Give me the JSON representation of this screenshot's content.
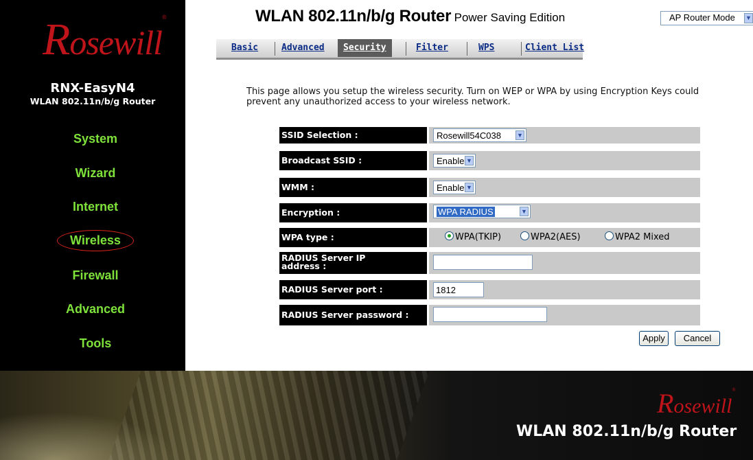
{
  "brand": {
    "logo_rest": "osewill",
    "logo_cap": "R",
    "registered": "®"
  },
  "sidebar": {
    "model": "RNX-EasyN4",
    "model_sub": "WLAN 802.11n/b/g Router",
    "items": [
      {
        "label": "System"
      },
      {
        "label": "Wizard"
      },
      {
        "label": "Internet"
      },
      {
        "label": "Wireless"
      },
      {
        "label": "Firewall"
      },
      {
        "label": "Advanced"
      },
      {
        "label": "Tools"
      }
    ],
    "active": "Wireless"
  },
  "header": {
    "title": "WLAN 802.11n/b/g Router",
    "subtitle": "Power Saving Edition",
    "mode_select": "AP Router Mode"
  },
  "tabs": [
    {
      "label": "Basic"
    },
    {
      "label": "Advanced"
    },
    {
      "label": "Security"
    },
    {
      "label": "Filter"
    },
    {
      "label": "WPS"
    },
    {
      "label": "Client List"
    }
  ],
  "active_tab": "Security",
  "description": "This page allows you setup the wireless security. Turn on WEP or WPA by using Encryption Keys could prevent any unauthorized access to your wireless network.",
  "form": {
    "ssid_selection": {
      "label": "SSID Selection :",
      "value": "Rosewill54C038"
    },
    "broadcast_ssid": {
      "label": "Broadcast SSID :",
      "value": "Enable"
    },
    "wmm": {
      "label": "WMM :",
      "value": "Enable"
    },
    "encryption": {
      "label": "Encryption :",
      "value": "WPA RADIUS"
    },
    "wpa_type": {
      "label": "WPA type :",
      "options": [
        "WPA(TKIP)",
        "WPA2(AES)",
        "WPA2 Mixed"
      ],
      "selected": "WPA(TKIP)"
    },
    "radius_ip": {
      "label_line1": "RADIUS Server IP",
      "label_line2": "address :",
      "value": ""
    },
    "radius_port": {
      "label": "RADIUS Server port :",
      "value": "1812"
    },
    "radius_password": {
      "label": "RADIUS Server password :",
      "value": ""
    }
  },
  "buttons": {
    "apply": "Apply",
    "cancel": "Cancel"
  },
  "footer": {
    "model": "WLAN 802.11n/b/g Router"
  },
  "colors": {
    "nav_green": "#7ee23a",
    "logo_red": "#c0141b",
    "tab_blue": "#0a2b86",
    "label_bg": "#000000",
    "value_bg": "#c9c9c9"
  }
}
